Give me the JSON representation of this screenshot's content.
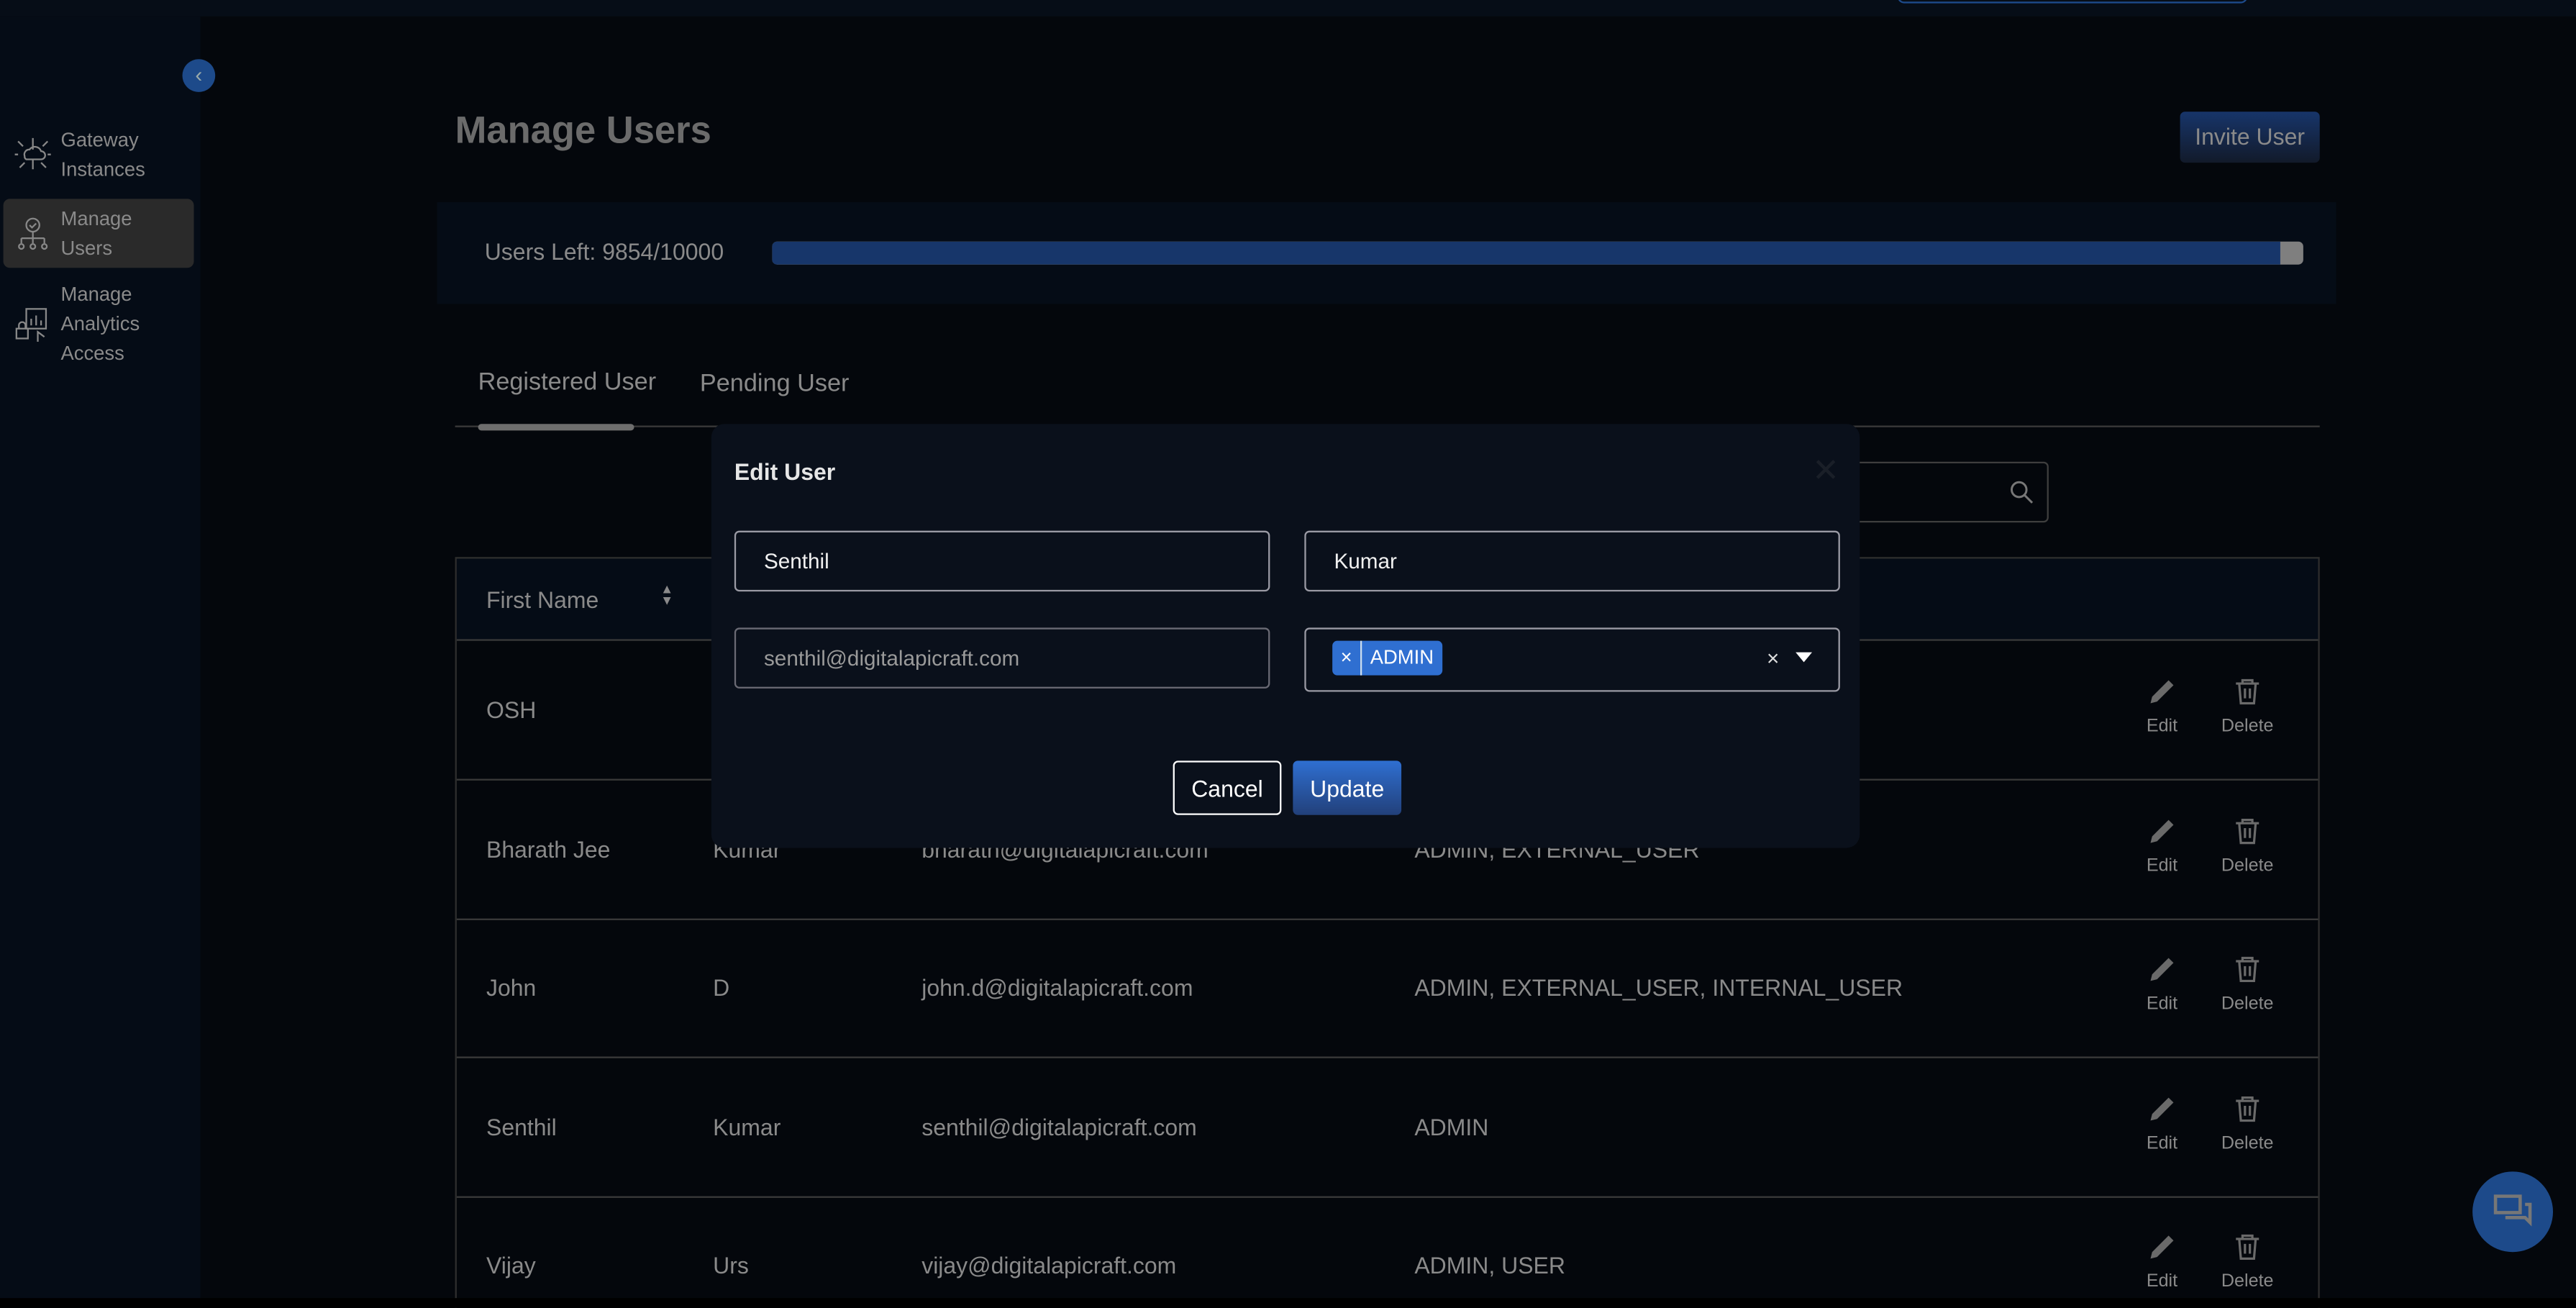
{
  "sidebar": {
    "items": [
      {
        "label1": "Gateway",
        "label2": "Instances",
        "icon": "gateway-cloud-icon"
      },
      {
        "label1": "Manage",
        "label2": "Users",
        "icon": "manage-users-icon",
        "active": true
      },
      {
        "label1": "Manage",
        "label2": "Analytics",
        "label3": "Access",
        "icon": "analytics-access-icon"
      }
    ]
  },
  "header": {
    "title": "Manage Users",
    "invite_label": "Invite User"
  },
  "quota": {
    "text": "Users Left: 9854/10000",
    "used_percent": 98.5
  },
  "tabs": [
    {
      "label": "Registered User",
      "active": true
    },
    {
      "label": "Pending User"
    }
  ],
  "table": {
    "headers": [
      "First Name"
    ],
    "rows": [
      {
        "first": "OSH",
        "last": "",
        "email": "",
        "roles": ""
      },
      {
        "first": "Bharath Jee",
        "last": "Kumar",
        "email": "bharath@digitalapicraft.com",
        "roles": "ADMIN, EXTERNAL_USER"
      },
      {
        "first": "John",
        "last": "D",
        "email": "john.d@digitalapicraft.com",
        "roles": "ADMIN, EXTERNAL_USER, INTERNAL_USER"
      },
      {
        "first": "Senthil",
        "last": "Kumar",
        "email": "senthil@digitalapicraft.com",
        "roles": "ADMIN"
      },
      {
        "first": "Vijay",
        "last": "Urs",
        "email": "vijay@digitalapicraft.com",
        "roles": "ADMIN, USER"
      }
    ],
    "edit_label": "Edit",
    "delete_label": "Delete"
  },
  "modal": {
    "title": "Edit User",
    "first_name": "Senthil",
    "last_name": "Kumar",
    "email": "senthil@digitalapicraft.com",
    "roles": [
      "ADMIN"
    ],
    "chip_remove": "×",
    "clear": "×",
    "cancel_label": "Cancel",
    "update_label": "Update"
  },
  "colors": {
    "accent": "#2f6fd1",
    "brand_dark": "#1d4a8a",
    "bg": "#04070c",
    "modal_bg": "#0a101b"
  }
}
